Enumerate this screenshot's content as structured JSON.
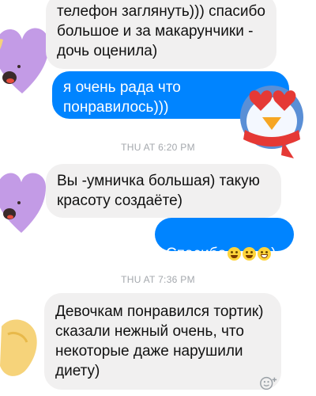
{
  "messages": [
    {
      "from": "them",
      "text": "телефон заглянуть))) спасибо\nбольшое и за макарунчики -\nдочь оценила)"
    },
    {
      "from": "me",
      "text": "я очень рада что\nпонравилось)))"
    },
    {
      "from": "them",
      "text": "Вы -умничка большая) такую\nкрасоту создаёте)"
    },
    {
      "from": "me",
      "text": "Спасибо",
      "trailing_emoji": [
        "smiling-face-icon",
        "grinning-face-icon",
        "grimacing-face-icon"
      ],
      "trailing_text": ")"
    },
    {
      "from": "them",
      "text": "Девочкам понравился  тортик)\nсказали нежный очень, что\nнекоторые даже нарушили\nдиету)"
    }
  ],
  "timestamps": [
    "THU AT 6:20 PM",
    "THU AT 7:36 PM"
  ],
  "colors": {
    "outgoing": "#0084ff",
    "incoming": "#f1f0f0",
    "timestamp": "#a4a8ad",
    "heart_sticker": "#c39be6"
  }
}
